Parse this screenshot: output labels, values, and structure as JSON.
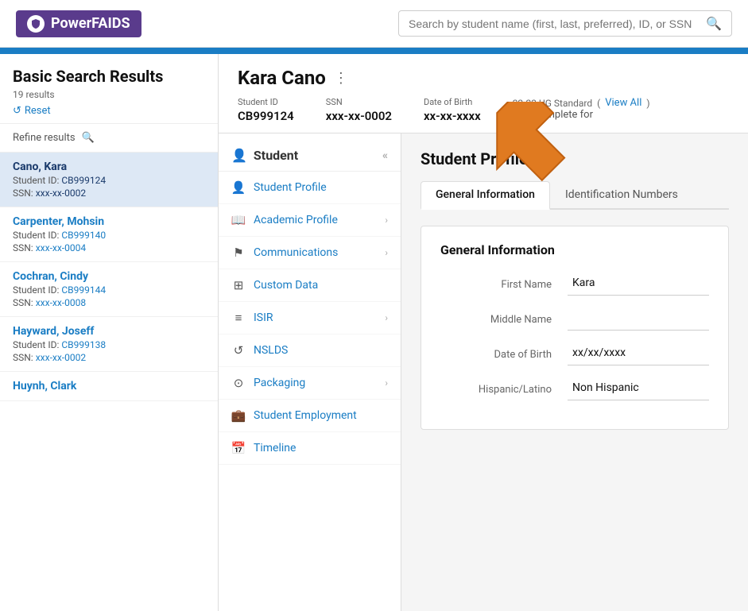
{
  "header": {
    "logo_text": "PowerFAIDS",
    "search_placeholder": "Search by student name (first, last, preferred), ID, or SSN"
  },
  "sidebar": {
    "title": "Basic Search Results",
    "count": "19 results",
    "reset_label": "Reset",
    "refine_label": "Refine results",
    "students": [
      {
        "name": "Cano, Kara",
        "id_label": "Student ID:",
        "id_val": "CB999124",
        "ssn_label": "SSN:",
        "ssn_val": "xxx-xx-0002",
        "active": true
      },
      {
        "name": "Carpenter, Mohsin",
        "id_label": "Student ID:",
        "id_val": "CB999140",
        "ssn_label": "SSN:",
        "ssn_val": "xxx-xx-0004",
        "active": false
      },
      {
        "name": "Cochran, Cindy",
        "id_label": "Student ID:",
        "id_val": "CB999144",
        "ssn_label": "SSN:",
        "ssn_val": "xxx-xx-0008",
        "active": false
      },
      {
        "name": "Hayward, Joseff",
        "id_label": "Student ID:",
        "id_val": "CB999138",
        "ssn_label": "SSN:",
        "ssn_val": "xxx-xx-0002",
        "active": false
      },
      {
        "name": "Huynh, Clark",
        "id_label": "",
        "id_val": "",
        "ssn_label": "",
        "ssn_val": "",
        "active": false
      }
    ]
  },
  "student": {
    "name": "Kara Cano",
    "student_id_label": "Student ID",
    "student_id": "CB999124",
    "ssn_label": "SSN",
    "ssn": "xxx-xx-0002",
    "dob_label": "Date of Birth",
    "dob": "xx-xx-xxxx",
    "aid_label": "22-23 UG Standard",
    "view_all": "View All",
    "status": "Incomplete for"
  },
  "side_nav": {
    "header": "Student",
    "items": [
      {
        "label": "Student Profile",
        "has_arrow": false,
        "icon": "person"
      },
      {
        "label": "Academic Profile",
        "has_arrow": true,
        "icon": "book"
      },
      {
        "label": "Communications",
        "has_arrow": true,
        "icon": "flag"
      },
      {
        "label": "Custom Data",
        "has_arrow": false,
        "icon": "grid"
      },
      {
        "label": "ISIR",
        "has_arrow": true,
        "icon": "list"
      },
      {
        "label": "NSLDS",
        "has_arrow": false,
        "icon": "refresh"
      },
      {
        "label": "Packaging",
        "has_arrow": true,
        "icon": "package"
      },
      {
        "label": "Student Employment",
        "has_arrow": false,
        "icon": "briefcase"
      },
      {
        "label": "Timeline",
        "has_arrow": false,
        "icon": "calendar"
      }
    ]
  },
  "profile": {
    "title": "Student Profile",
    "tabs": [
      {
        "label": "General Information",
        "active": true
      },
      {
        "label": "Identification Numbers",
        "active": false
      }
    ],
    "section_title": "General Information",
    "fields": [
      {
        "label": "First Name",
        "value": "Kara"
      },
      {
        "label": "Middle Name",
        "value": ""
      },
      {
        "label": "Date of Birth",
        "value": "xx/xx/xxxx"
      },
      {
        "label": "Hispanic/Latino",
        "value": "Non Hispanic"
      }
    ]
  }
}
